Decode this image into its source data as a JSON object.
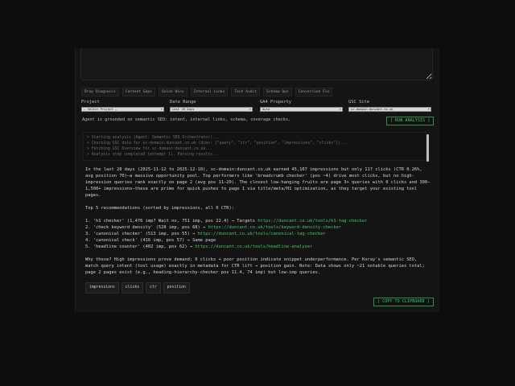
{
  "tabs": [
    "Drop Diagnosis",
    "Content Gaps",
    "Quick Wins",
    "Internal Links",
    "Tech Audit",
    "Schema Ops",
    "Conversion Fix"
  ],
  "filters": {
    "project": {
      "label": "Project",
      "value": "— Select Project —"
    },
    "date_range": {
      "label": "Date Range",
      "value": "Last 28 Days"
    },
    "ga4": {
      "label": "GA4 Property",
      "value": "Auto"
    },
    "gsc": {
      "label": "GSC Site",
      "value": "sc-domain:duncant.co.uk"
    }
  },
  "grounded_text": "Agent is grounded on semantic SEO: intent, internal links, schema, coverage checks.",
  "run_button": "[ RUN ANALYSIS ]",
  "log": [
    "> Starting analysis (Agent: Semantic SEO Orchestrator)...",
    "> Checking GSC data for sc-domain:duncant.co.uk (dims: [\"query\", \"ctr\", \"position\", \"impressions\", \"clicks\"])...",
    "> Fetching GSC Overview for sc-domain:duncant.co.uk...",
    "> Analysis step completed (attempt 1). Parsing results..."
  ],
  "summary": "In the last 28 days (2025-11-12 to 2025-12-10), sc-domain:duncant.co.uk earned 45,107 impressions but only 117 clicks (CTR 0.26%, avg position 70)—a massive opportunity pool. Top performers like 'breadcrumb checker' (pos ~4) drive most clicks, but no high-impression queries rank exactly on page 2 (avg pos 11–20). The closest low-hanging fruits are page 3+ queries with 0 clicks and 300–1,500+ impressions—these are prime for quick pushes to page 1 via title/meta/H1 optimization, as they target your existing tool pages.",
  "top_heading": "Top 5 recommendations (sorted by impressions, all 0 CTR):",
  "recs": [
    {
      "text": "1. 'h1 checker' (1,476 imp? Wait no, 751 imp, pos 22.4) → Targets ",
      "url": "https://duncant.co.uk/tools/h1-tag-checker"
    },
    {
      "text": "2. 'check keyword density' (528 imp, pos 68) → ",
      "url": "https://duncant.co.uk/tools/keyword-density-checker"
    },
    {
      "text": "3. 'canonical checker' (513 imp, pos 55) → ",
      "url": "https://duncant.co.uk/tools/canonical-tag-checker"
    },
    {
      "text": "4. 'canonical check' (416 imp, pos 57) → Same page",
      "url": ""
    },
    {
      "text": "5. 'headline counter' (402 imp, pos 62) → ",
      "url": "https://duncant.co.uk/tools/headline-analyzer"
    }
  ],
  "why": "Why these? High impressions prove demand; 0 clicks + poor position indicate snippet underperformance. Per Koray's semantic SEO, match query intent (tool usage) exactly in metadata for CTR lift → position gain. Note: Data shows only ~21 notable queries total; page 2 pages exist (e.g., heading-hierarchy-checker pos 11.4, 74 imp) but low-imp queries.",
  "chips": [
    "impressions",
    "clicks",
    "ctr",
    "position"
  ],
  "copy_button": "[ COPY TO CLIPBOARD ]"
}
